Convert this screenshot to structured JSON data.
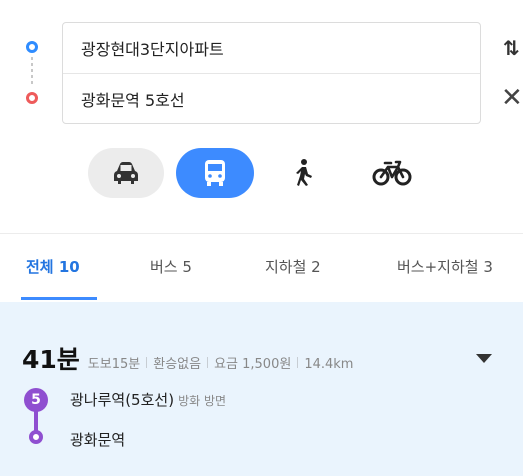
{
  "route": {
    "origin": "광장현대3단지아파트",
    "destination": "광화문역 5호선"
  },
  "modes": {
    "car_icon": "car-icon",
    "bus_icon": "bus-icon",
    "walk_icon": "walking-icon",
    "bike_icon": "bicycle-icon",
    "active_color": "#3d8bff"
  },
  "tabs": [
    {
      "label": "전체 10"
    },
    {
      "label": "버스 5"
    },
    {
      "label": "지하철 2"
    },
    {
      "label": "버스+지하철 3"
    }
  ],
  "result": {
    "time": "41분",
    "walk": "도보15분",
    "transfer": "환승없음",
    "fare": "요금 1,500원",
    "distance": "14.4km",
    "line_number": "5",
    "line_color": "#8f4fd0",
    "start_station": "광나루역(5호선)",
    "direction": "방화 방면",
    "end_station": "광화문역"
  }
}
